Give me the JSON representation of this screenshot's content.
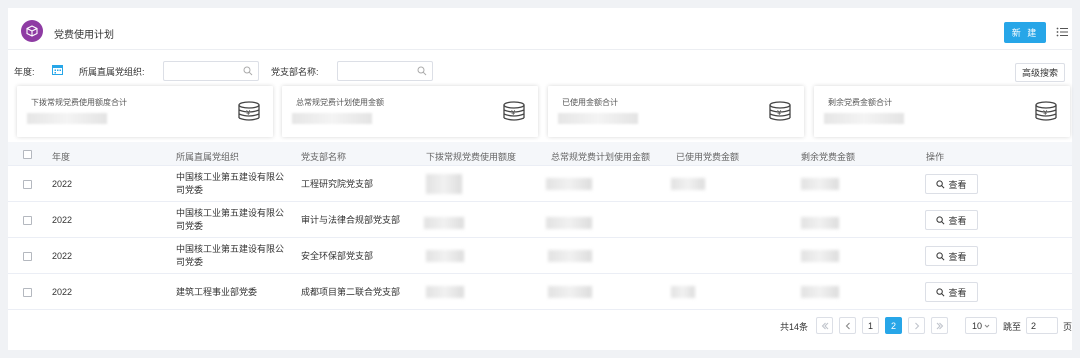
{
  "header": {
    "title": "党费使用计划",
    "new_label": "新 建"
  },
  "filters": {
    "year_label": "年度:",
    "org_label": "所属直属党组织:",
    "org_value": "",
    "branch_label": "党支部名称:",
    "branch_value": "",
    "advanced_label": "高级搜索"
  },
  "cards": [
    {
      "title": "下拨常规党费使用额度合计"
    },
    {
      "title": "总常规党费计划使用金额"
    },
    {
      "title": "已使用金额合计"
    },
    {
      "title": "剩余党费金额合计"
    }
  ],
  "table": {
    "columns": [
      "年度",
      "所属直属党组织",
      "党支部名称",
      "下拨常规党费使用额度",
      "总常规党费计划使用金额",
      "已使用党费金额",
      "剩余党费金额",
      "操作"
    ],
    "view_label": "查看",
    "rows": [
      {
        "year": "2022",
        "org": "中国核工业第五建设有限公司党委",
        "branch": "工程研究院党支部"
      },
      {
        "year": "2022",
        "org": "中国核工业第五建设有限公司党委",
        "branch": "审计与法律合规部党支部"
      },
      {
        "year": "2022",
        "org": "中国核工业第五建设有限公司党委",
        "branch": "安全环保部党支部"
      },
      {
        "year": "2022",
        "org": "建筑工程事业部党委",
        "branch": "成都项目第二联合党支部"
      }
    ]
  },
  "pagination": {
    "total_label": "共14条",
    "pages": [
      "1",
      "2"
    ],
    "current_page": "2",
    "page_size": "10",
    "goto_label": "跳至",
    "goto_value": "2",
    "page_unit": "页"
  },
  "colors": {
    "accent": "#27a6e8",
    "logo": "#8e3ba3"
  }
}
